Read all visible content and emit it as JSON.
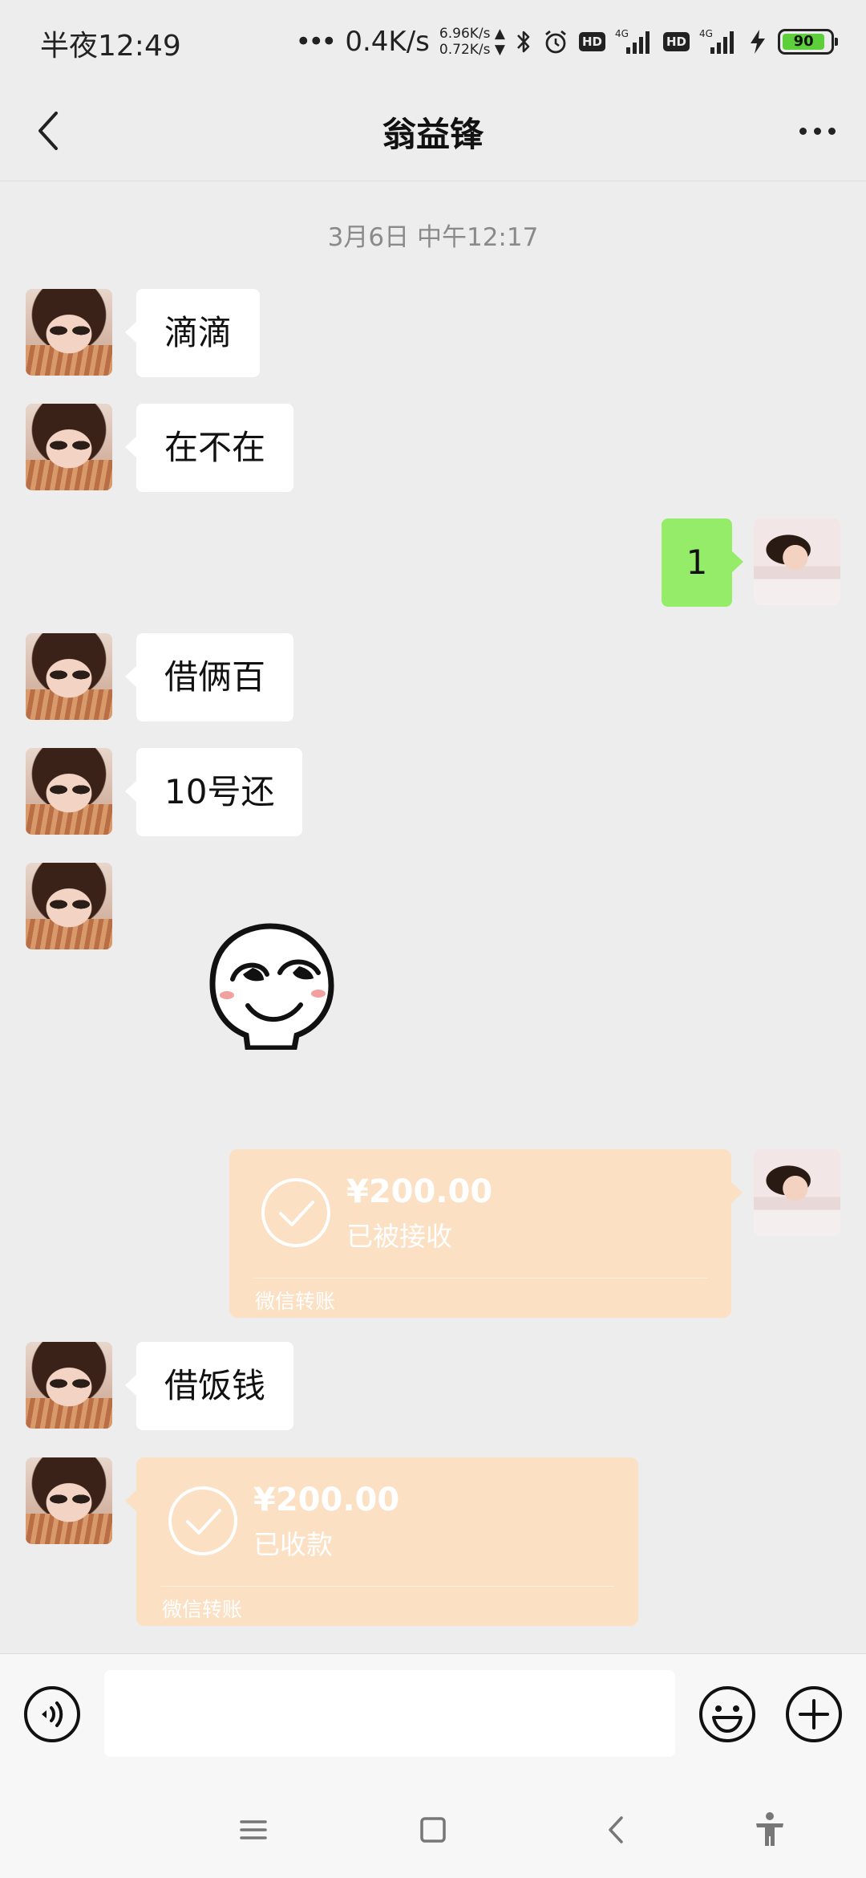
{
  "status_bar": {
    "time": "半夜12:49",
    "net_dots": "•••",
    "net_speed": "0.4K/s",
    "net_up": "6.96K/s ▲",
    "net_down": "0.72K/s ▼",
    "hd1": "HD",
    "signal1_label": "4G",
    "hd2": "HD",
    "signal2_label": "4G",
    "battery": "90",
    "battery_level_percent": 90,
    "icons": [
      "bluetooth-icon",
      "alarm-icon",
      "signal-icon",
      "charging-icon",
      "battery-icon"
    ]
  },
  "header": {
    "title": "翁益锋",
    "icons": [
      "back-icon",
      "more-icon"
    ]
  },
  "chat": {
    "timestamp": "3月6日 中午12:17",
    "messages": [
      {
        "side": "left",
        "type": "text",
        "text": "滴滴"
      },
      {
        "side": "left",
        "type": "text",
        "text": "在不在"
      },
      {
        "side": "right",
        "type": "text",
        "text": "1"
      },
      {
        "side": "left",
        "type": "text",
        "text": "借俩百"
      },
      {
        "side": "left",
        "type": "text",
        "text": "10号还"
      },
      {
        "side": "left",
        "type": "sticker",
        "icon": "smirk-face-sticker"
      },
      {
        "side": "right",
        "type": "transfer",
        "amount": "¥200.00",
        "status": "已被接收",
        "footer": "微信转账"
      },
      {
        "side": "left",
        "type": "text",
        "text": "借饭钱"
      },
      {
        "side": "left",
        "type": "transfer",
        "amount": "¥200.00",
        "status": "已收款",
        "footer": "微信转账"
      }
    ]
  },
  "input_bar": {
    "value": "",
    "icons": [
      "voice-icon",
      "emoji-icon",
      "plus-icon"
    ]
  },
  "system_nav": {
    "icons": [
      "menu-icon",
      "home-icon",
      "back-nav-icon",
      "accessibility-icon"
    ]
  },
  "colors": {
    "background": "#ededed",
    "incoming_bubble": "#ffffff",
    "outgoing_bubble": "#95ec69",
    "transfer_card": "#fbe0c3",
    "timestamp_text": "#8a8a8a"
  }
}
